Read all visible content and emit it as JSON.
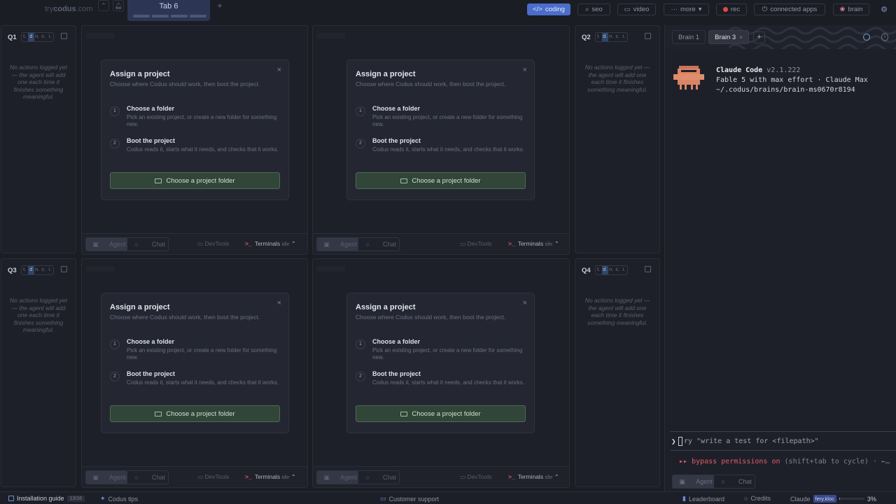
{
  "topbar": {
    "logo_prefix": "try",
    "logo_brand": "codus",
    "logo_suffix": ".com",
    "tab": "Tab 6",
    "add": "+",
    "pills": [
      {
        "label": "coding",
        "icon": "</>"
      },
      {
        "label": "seo",
        "icon": "search-icon"
      },
      {
        "label": "video",
        "icon": "video-icon"
      },
      {
        "label": "more",
        "icon": "dots-icon"
      },
      {
        "label": "rec",
        "icon": "rec-dot-icon"
      },
      {
        "label": "connected apps",
        "icon": "plug-icon"
      },
      {
        "label": "brain",
        "icon": "brain-icon"
      }
    ],
    "accent": "#4a6ec9"
  },
  "sides": [
    {
      "label": "Q1",
      "tabs": [
        "t.",
        "d",
        "n.",
        "c.",
        "i."
      ],
      "empty": "No actions logged yet — the agent will add one each time it finishes something meaningful."
    },
    {
      "label": "Q2",
      "tabs": [
        "t.",
        "d.",
        "n.",
        "c.",
        "i."
      ],
      "empty": "No actions logged yet — the agent will add one each time it finishes something meaningful."
    },
    {
      "label": "Q3",
      "tabs": [
        "t.",
        "d",
        "n.",
        "c.",
        "i."
      ],
      "empty": "No actions logged yet — the agent will add one each time it finishes something meaningful."
    },
    {
      "label": "Q4",
      "tabs": [
        "t.",
        "d.",
        "n.",
        "c.",
        "i."
      ],
      "empty": "No actions logged yet — the agent will add one each time it finishes something meaningful."
    }
  ],
  "modal": {
    "title": "Assign a project",
    "subtitle": "Choose where Codus should work, then boot the project.",
    "close": "×",
    "steps": [
      {
        "num": "1",
        "title": "Choose a folder",
        "desc": "Pick an existing project, or create a new folder for something new."
      },
      {
        "num": "2",
        "title": "Boot the project",
        "desc": "Codus reads it, starts what it needs, and checks that it works."
      }
    ],
    "button": "Choose a project folder"
  },
  "pane_footer": {
    "agent": "Agent",
    "chat": "Chat",
    "devtools": "DevTools",
    "terminals": "Terminals",
    "idle": "idle"
  },
  "brain": {
    "tabs": [
      "Brain 1",
      "Brain 3"
    ],
    "close": "×",
    "add": "+",
    "cc_name": "Claude Code",
    "cc_version": "v2.1.222",
    "model_line": "Fable 5 with max effort · Claude Max",
    "path_line": "~/.codus/brains/brain-ms0670r8194",
    "prompt_caret": "❯",
    "prompt_placeholder": "ry \"write a test for <filepath>\"",
    "bypass_prefix": "▸▸ bypass permissions on",
    "bypass_suffix": "(shift+tab to cycle) · ←…",
    "agent": "Agent",
    "chat": "Chat"
  },
  "bottombar": {
    "install": "Installation guide",
    "install_badge": "13/16",
    "tips": "Codus tips",
    "support": "Customer support",
    "leaderboard": "Leaderboard",
    "credits": "Credits",
    "claude": "Claude",
    "user": "fery.kloc",
    "percent": "3%",
    "percent_value": 0.03
  }
}
